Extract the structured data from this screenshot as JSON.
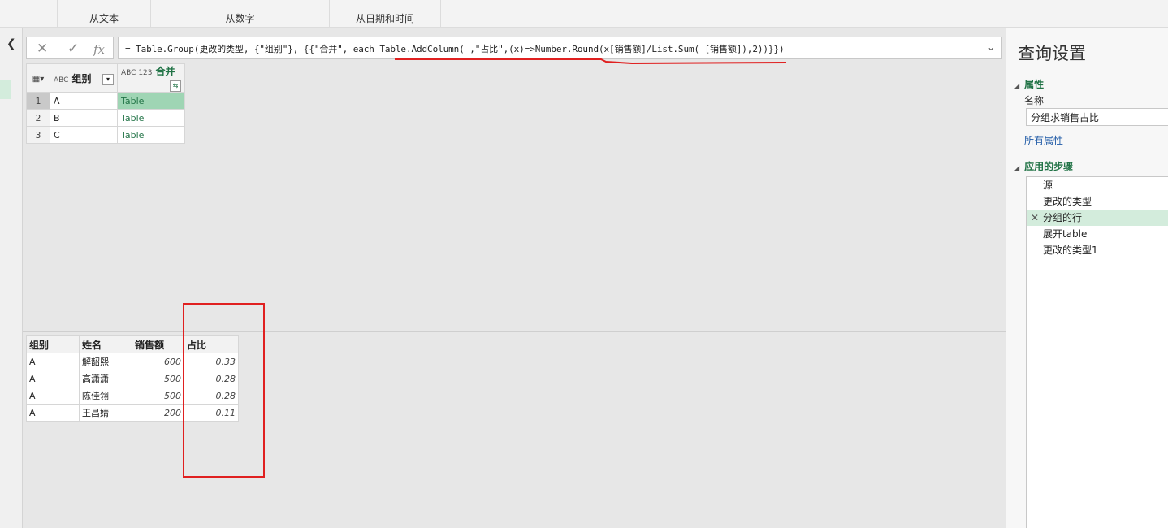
{
  "ribbon": {
    "groups": [
      "从文本",
      "从数字",
      "从日期和时间"
    ]
  },
  "nav": {
    "collapse_icon": "chevron-left-icon"
  },
  "formula_bar": {
    "cancel_glyph": "✕",
    "commit_glyph": "✓",
    "fx_glyph": "fx",
    "formula": "= Table.Group(更改的类型, {\"组别\"}, {{\"合并\", each Table.AddColumn(_,\"占比\",(x)=>Number.Round(x[销售额]/List.Sum(_[销售额]),2))}})",
    "dropdown_glyph": "⌄"
  },
  "grid": {
    "columns": [
      {
        "type_icon": "ABC",
        "label": "组别"
      },
      {
        "type_icon": "ABC 123",
        "label": "合并"
      }
    ],
    "rows": [
      {
        "n": "1",
        "group": "A",
        "merged": "Table"
      },
      {
        "n": "2",
        "group": "B",
        "merged": "Table"
      },
      {
        "n": "3",
        "group": "C",
        "merged": "Table"
      }
    ]
  },
  "preview": {
    "headers": [
      "组别",
      "姓名",
      "销售额",
      "占比"
    ],
    "rows": [
      {
        "group": "A",
        "name": "解韶熙",
        "sales": "600",
        "ratio": "0.33"
      },
      {
        "group": "A",
        "name": "高潇潇",
        "sales": "500",
        "ratio": "0.28"
      },
      {
        "group": "A",
        "name": "陈佳翎",
        "sales": "500",
        "ratio": "0.28"
      },
      {
        "group": "A",
        "name": "王昌婧",
        "sales": "200",
        "ratio": "0.11"
      }
    ]
  },
  "query_settings": {
    "title": "查询设置",
    "properties_label": "属性",
    "name_label": "名称",
    "name_value": "分组求销售占比",
    "all_properties_link": "所有属性",
    "applied_steps_label": "应用的步骤",
    "steps": [
      "源",
      "更改的类型",
      "分组的行",
      "展开table",
      "更改的类型1"
    ],
    "selected_step_index": 2
  },
  "colors": {
    "accent_green": "#217346",
    "annotation_red": "#e02020"
  }
}
